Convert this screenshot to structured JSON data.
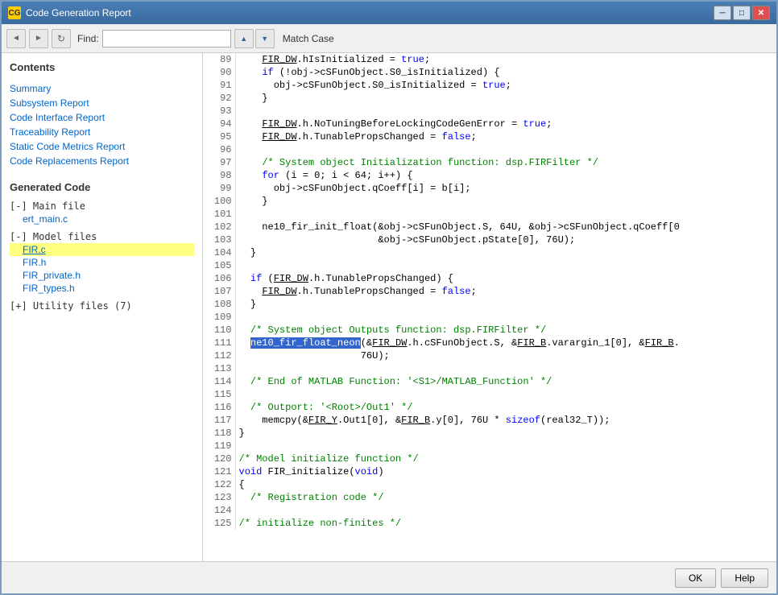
{
  "window": {
    "title": "Code Generation Report",
    "icon": "CG"
  },
  "toolbar": {
    "find_label": "Find:",
    "find_value": "",
    "find_placeholder": "",
    "match_case_label": "Match Case"
  },
  "sidebar": {
    "contents_title": "Contents",
    "nav_links": [
      {
        "id": "summary",
        "label": "Summary"
      },
      {
        "id": "subsystem-report",
        "label": "Subsystem Report"
      },
      {
        "id": "code-interface-report",
        "label": "Code Interface Report"
      },
      {
        "id": "traceability-report",
        "label": "Traceability Report"
      },
      {
        "id": "static-code-metrics",
        "label": "Static Code Metrics Report"
      },
      {
        "id": "code-replacements",
        "label": "Code Replacements Report"
      }
    ],
    "generated_code_title": "Generated Code",
    "main_file_label": "[-] Main file",
    "main_files": [
      {
        "id": "ert-main-c",
        "label": "ert_main.c"
      }
    ],
    "model_file_label": "[-] Model files",
    "model_files": [
      {
        "id": "fir-c",
        "label": "FIR.c",
        "active": true
      },
      {
        "id": "fir-h",
        "label": "FIR.h",
        "active": false
      },
      {
        "id": "fir-private-h",
        "label": "FIR_private.h",
        "active": false
      },
      {
        "id": "fir-types-h",
        "label": "FIR_types.h",
        "active": false
      }
    ],
    "utility_label": "[+] Utility files (7)"
  },
  "code": {
    "lines": [
      {
        "num": 89,
        "text": "    FIR_DW.hIsInitialized = true;"
      },
      {
        "num": 90,
        "text": "    if (!obj->cSFunObject.S0_isInitialized) {"
      },
      {
        "num": 91,
        "text": "      obj->cSFunObject.S0_isInitialized = true;"
      },
      {
        "num": 92,
        "text": "    }"
      },
      {
        "num": 93,
        "text": ""
      },
      {
        "num": 94,
        "text": "    FIR_DW.h.NoTuningBeforeLockingCodeGenError = true;"
      },
      {
        "num": 95,
        "text": "    FIR_DW.h.TunablePropsChanged = false;"
      },
      {
        "num": 96,
        "text": ""
      },
      {
        "num": 97,
        "text": "    /* System object Initialization function: dsp.FIRFilter */"
      },
      {
        "num": 98,
        "text": "    for (i = 0; i < 64; i++) {"
      },
      {
        "num": 99,
        "text": "      obj->cSFunObject.qCoeff[i] = b[i];"
      },
      {
        "num": 100,
        "text": "    }"
      },
      {
        "num": 101,
        "text": ""
      },
      {
        "num": 102,
        "text": "    ne10_fir_init_float(&obj->cSFunObject.S, 64U, &obj->cSFunObject.qCoeff[0"
      },
      {
        "num": 103,
        "text": "                        &obj->cSFunObject.pState[0], 76U);"
      },
      {
        "num": 104,
        "text": "  }"
      },
      {
        "num": 105,
        "text": ""
      },
      {
        "num": 106,
        "text": "  if (FIR_DW.h.TunablePropsChanged) {"
      },
      {
        "num": 107,
        "text": "    FIR_DW.h.TunablePropsChanged = false;"
      },
      {
        "num": 108,
        "text": "  }"
      },
      {
        "num": 109,
        "text": ""
      },
      {
        "num": 110,
        "text": "  /* System object Outputs function: dsp.FIRFilter */"
      },
      {
        "num": 111,
        "text": "  ne10_fir_float_neon(&FIR_DW.h.cSFunObject.S, &FIR_B.varargin_1[0], &FIR_B."
      },
      {
        "num": 112,
        "text": "                     76U);"
      },
      {
        "num": 113,
        "text": ""
      },
      {
        "num": 114,
        "text": "  /* End of MATLAB Function: '<S1>/MATLAB_Function' */"
      },
      {
        "num": 115,
        "text": ""
      },
      {
        "num": 116,
        "text": "  /* Outport: '<Root>/Out1' */"
      },
      {
        "num": 117,
        "text": "    memcpy(&FIR_Y.Out1[0], &FIR_B.y[0], 76U * sizeof(real32_T));"
      },
      {
        "num": 118,
        "text": "}"
      },
      {
        "num": 119,
        "text": ""
      },
      {
        "num": 120,
        "text": "/* Model initialize function */"
      },
      {
        "num": 121,
        "text": "void FIR_initialize(void)"
      },
      {
        "num": 122,
        "text": "{"
      },
      {
        "num": 123,
        "text": "  /* Registration code */"
      },
      {
        "num": 124,
        "text": ""
      },
      {
        "num": 125,
        "text": "/* initialize non-finites */"
      }
    ]
  },
  "buttons": {
    "ok_label": "OK",
    "help_label": "Help"
  },
  "icons": {
    "back": "◄",
    "forward": "►",
    "refresh": "↻",
    "up_arrow": "▲",
    "down_arrow": "▼",
    "minimize": "─",
    "maximize": "□",
    "close": "✕"
  }
}
